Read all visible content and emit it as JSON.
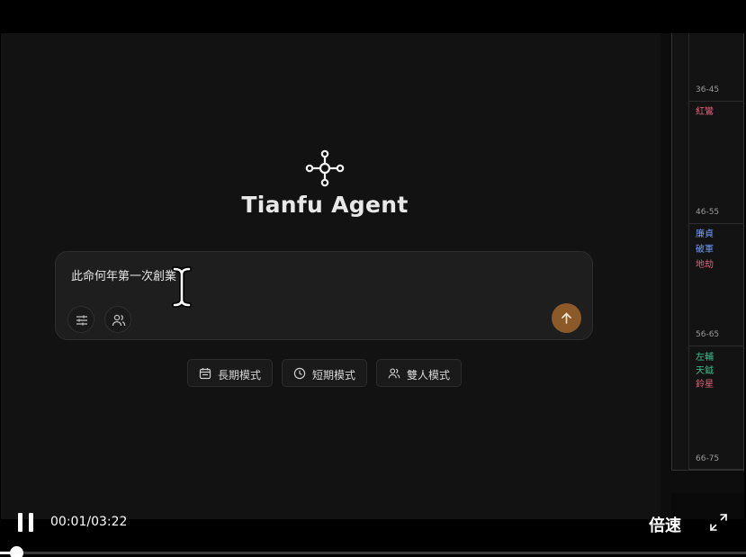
{
  "app": {
    "title": "Tianfu Agent",
    "logo_icon": "network-hub-icon"
  },
  "composer": {
    "value": "此命何年第一次創業",
    "settings_icon": "sliders-icon",
    "people_icon": "users-icon",
    "send_icon": "arrow-up-icon",
    "send_color": "#8b5a28"
  },
  "modes": [
    {
      "label": "長期模式",
      "icon": "calendar-icon"
    },
    {
      "label": "短期模式",
      "icon": "clock-icon"
    },
    {
      "label": "雙人模式",
      "icon": "users-icon"
    }
  ],
  "chart_panel": {
    "ages": [
      "36-45",
      "46-55",
      "56-65",
      "66-75"
    ],
    "stars": [
      {
        "text": "紅鸞",
        "color": "#e0607a"
      },
      {
        "text": "廉貞",
        "color": "#6fa0ff"
      },
      {
        "text": "破軍",
        "color": "#6fa0ff"
      },
      {
        "text": "地劫",
        "color": "#e0607a"
      },
      {
        "text": "左輔",
        "color": "#3fbf8f"
      },
      {
        "text": "天鉞",
        "color": "#3fbf8f"
      },
      {
        "text": "鈴星",
        "color": "#e0607a"
      }
    ]
  },
  "player": {
    "time": "00:01/03:22",
    "speed_label": "倍速",
    "progress": 0.005,
    "pause_icon": "pause-icon",
    "fullscreen_icon": "fullscreen-icon"
  }
}
